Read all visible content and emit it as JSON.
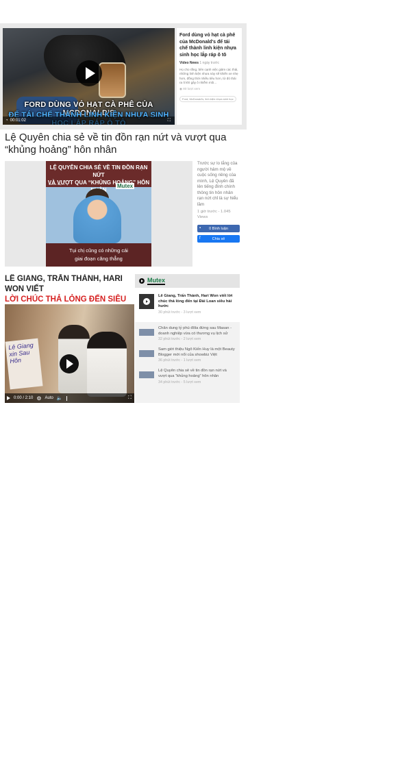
{
  "block1": {
    "overlay_line1": "FORD DÙNG VỎ HẠT CÀ PHÊ CỦA MCDONALD'S",
    "overlay_line2": "ĐỂ TÁI CHẾ THÀNH LINH KIỆN NHỰA SINH HỌC LẮP RÁP Ô TÔ",
    "overlay_caption": "Ford dùng vỏ hạt cà phê của McDonald's để tái chế thành linh kiện nhựa sinh học lắp ráp ô tô",
    "time": "00:01:02",
    "title": "Ford dùng vỏ hạt cà phê của McDonald's để tái chế thành linh kiện nhựa sinh học lắp ráp ô tô",
    "source": "Video News",
    "age": "1 ngày trước",
    "description": "Họ cho rằng, bên cạnh việc giảm các thải, những linh kiện nhựa này sẽ khiến xe nhẹ hơn, đồng thời nhiều tiêu hơn, từ đó thải ra ít khí gây ô nhiễm môi...",
    "views": "80 lượt xem",
    "tags": "Ford, McDonald's, linh kiện nhựa sinh học"
  },
  "block2": {
    "title": "Lệ Quyên chia sẻ về tin đồn rạn nứt và vượt qua “khủng hoảng” hôn nhân",
    "thumb_head1": "LỆ QUYÊN CHIA SẺ VỀ TIN ĐỒN RẠN NỨT",
    "thumb_head2": "VÀ VƯỢT QUA “KHỦNG HOẢNG” HÔN NHÂN",
    "thumb_brand": "Mutex",
    "thumb_small": "NGUỒN: Stay TV",
    "thumb_sub1": "Tụi chị cũng có những cái",
    "thumb_sub2": "giai đoạn căng thẳng",
    "description": "Trước sự lo lắng của người hâm mộ về cuộc sống riêng của mình, Lệ Quyên đã lên tiếng đính chính thông tin hôn nhân rạn nứt chỉ là sự hiểu lầm",
    "meta": "1 giờ trước - 1.045 Views",
    "comment_label": "0 Bình luận",
    "share_label": "Chia sẻ"
  },
  "block3": {
    "head1": "LÊ GIANG, TRẤN THÀNH, HARI WON VIẾT",
    "head2": "LỜI CHÚC THẢ LỎNG ĐẾN SIÊU HÀI HƯỚC",
    "sign_text": "Lê Giang xin Sau Hôn",
    "time": "0:00 / 2:10",
    "quality": "Auto",
    "brand": "Mutex",
    "items": [
      {
        "title": "Lê Giang, Trấn Thành, Hari Won viết lời chúc thả lỏng đến tại Đài Loan siêu hài hước",
        "meta": "30 phút trước - 3 lượt xem"
      },
      {
        "title": "Chân dung tỷ phú đôla đứng sau Masan - doanh nghiệp vừa có thương vụ lịch sử",
        "meta": "32 phút trước - 2 lượt xem"
      },
      {
        "title": "Sam giới thiệu Ngô Kiến Huy là một Beauty Blogger mới nổi của showbiz Việt",
        "meta": "36 phút trước - 1 lượt xem"
      },
      {
        "title": "Lệ Quyên chia sẻ về tin đồn rạn nứt và vượt qua “khủng hoảng” hôn nhân",
        "meta": "34 phút trước - 5 lượt xem"
      }
    ]
  }
}
